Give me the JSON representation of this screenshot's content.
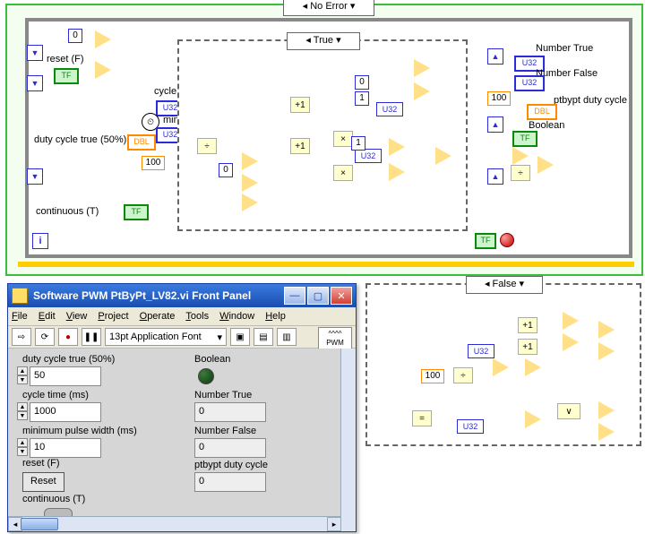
{
  "bd": {
    "no_error": "No Error",
    "case_true": "True",
    "labels": {
      "reset": "reset (F)",
      "cycle_time": "cycle time (ms)",
      "min_pulse": "minimum pulse width (ms)",
      "duty_cycle_true": "duty cycle true (50%)",
      "continuous": "continuous (T)",
      "number_true": "Number True",
      "number_false": "Number False",
      "ptbypt": "ptbypt duty cycle",
      "boolean": "Boolean"
    },
    "types": {
      "tf": "TF",
      "u32": "U32",
      "dbl": "DBL"
    },
    "consts": {
      "zero": "0",
      "one": "1",
      "hundred": "100"
    }
  },
  "fp": {
    "title": "Software PWM PtByPt_LV82.vi Front Panel",
    "menus": [
      "File",
      "Edit",
      "View",
      "Project",
      "Operate",
      "Tools",
      "Window",
      "Help"
    ],
    "font": "13pt Application Font",
    "icon_lines": [
      "^^^^",
      "PWM",
      "⎍+⎍"
    ],
    "labels": {
      "duty_cycle_true": "duty cycle true (50%)",
      "cycle_time": "cycle time (ms)",
      "min_pulse": "minimum pulse width (ms)",
      "reset": "reset  (F)",
      "continuous": "continuous (T)",
      "boolean": "Boolean",
      "number_true": "Number True",
      "number_false": "Number False",
      "ptbypt": "ptbypt duty cycle"
    },
    "values": {
      "duty_cycle_true": "50",
      "cycle_time": "1000",
      "min_pulse": "10",
      "number_true": "0",
      "number_false": "0",
      "ptbypt": "0"
    },
    "reset_btn": "Reset"
  },
  "case2": {
    "label": "False",
    "u32": "U32",
    "hundred": "100"
  }
}
